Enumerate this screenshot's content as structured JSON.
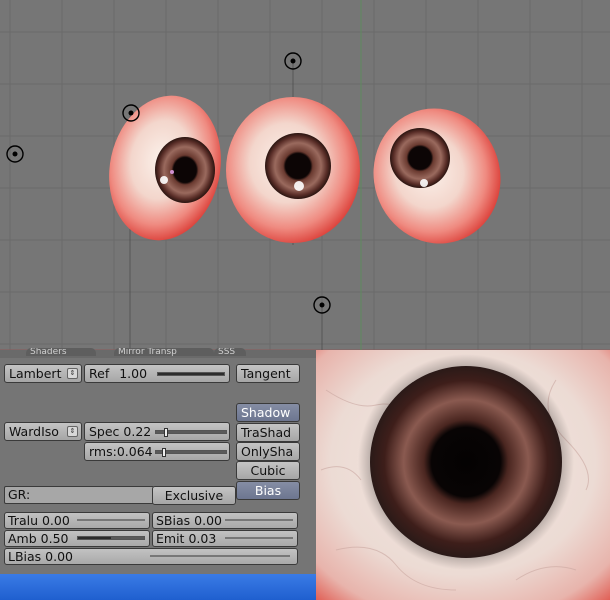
{
  "viewport": {
    "objects": [
      "eye-left",
      "eye-center",
      "eye-right"
    ],
    "empties": [
      "empty-top",
      "empty-left",
      "empty-eye",
      "empty-bottom"
    ]
  },
  "panel": {
    "tabs": [
      "Shaders",
      "Mirror Transp",
      "SSS"
    ],
    "diffuse_shader": "Lambert",
    "ref_label": "Ref",
    "ref_value": "1.00",
    "ref_level": 1.0,
    "tangent": "Tangent",
    "specular_shader": "WardIso",
    "spec_label": "Spec",
    "spec_value": "0.22",
    "spec_level": 0.11,
    "rms_label": "rms:",
    "rms_value": "0.064",
    "rms_level": 0.08,
    "shadow": "Shadow",
    "trashad": "TraShad",
    "onlysha": "OnlySha",
    "cubic": "Cubic",
    "bias": "Bias",
    "gr_label": "GR:",
    "exclusive": "Exclusive",
    "tralu_label": "Tralu",
    "tralu_value": "0.00",
    "sbias_label": "SBias",
    "sbias_value": "0.00",
    "amb_label": "Amb",
    "amb_value": "0.50",
    "amb_level": 0.5,
    "emit_label": "Emit",
    "emit_value": "0.03",
    "lbias_label": "LBias",
    "lbias_value": "0.00"
  },
  "colors": {
    "viewport_bg": "#767676",
    "panel_bg": "#757575",
    "button_selected": "#7a82a0",
    "taskbar": "#2a6ad8"
  }
}
